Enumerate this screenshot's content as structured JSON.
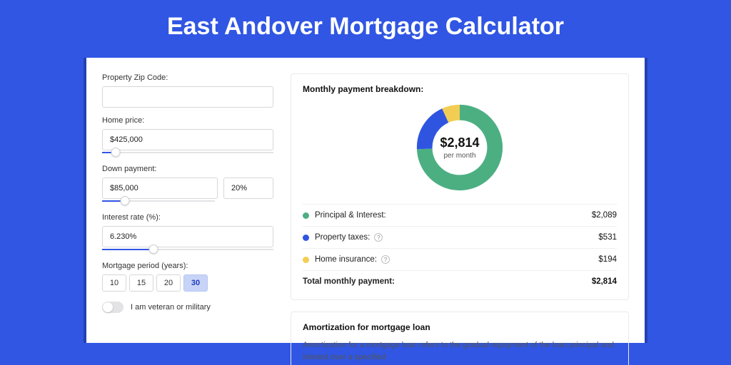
{
  "title": "East Andover Mortgage Calculator",
  "form": {
    "zip_label": "Property Zip Code:",
    "zip_value": "",
    "home_price_label": "Home price:",
    "home_price_value": "$425,000",
    "home_price_slider_pct": 8,
    "down_payment_label": "Down payment:",
    "down_payment_value": "$85,000",
    "down_payment_pct": "20%",
    "down_payment_slider_pct": 20,
    "rate_label": "Interest rate (%):",
    "rate_value": "6.230%",
    "rate_slider_pct": 30,
    "period_label": "Mortgage period (years):",
    "period_options": [
      "10",
      "15",
      "20",
      "30"
    ],
    "period_selected": "30",
    "veteran_label": "I am veteran or military"
  },
  "breakdown": {
    "title": "Monthly payment breakdown:",
    "center_value": "$2,814",
    "center_sub": "per month",
    "items": [
      {
        "label": "Principal & Interest:",
        "value": "$2,089",
        "color": "#4caf82",
        "help": false
      },
      {
        "label": "Property taxes:",
        "value": "$531",
        "color": "#2f55e0",
        "help": true
      },
      {
        "label": "Home insurance:",
        "value": "$194",
        "color": "#f3cd53",
        "help": true
      }
    ],
    "total_label": "Total monthly payment:",
    "total_value": "$2,814"
  },
  "amortization": {
    "title": "Amortization for mortgage loan",
    "body": "Amortization for a mortgage loan refers to the gradual repayment of the loan principal and interest over a specified"
  },
  "chart_data": {
    "type": "pie",
    "title": "Monthly payment breakdown",
    "series": [
      {
        "name": "Principal & Interest",
        "value": 2089,
        "color": "#4caf82"
      },
      {
        "name": "Property taxes",
        "value": 531,
        "color": "#2f55e0"
      },
      {
        "name": "Home insurance",
        "value": 194,
        "color": "#f3cd53"
      }
    ],
    "total": 2814,
    "center_label": "$2,814 per month"
  }
}
